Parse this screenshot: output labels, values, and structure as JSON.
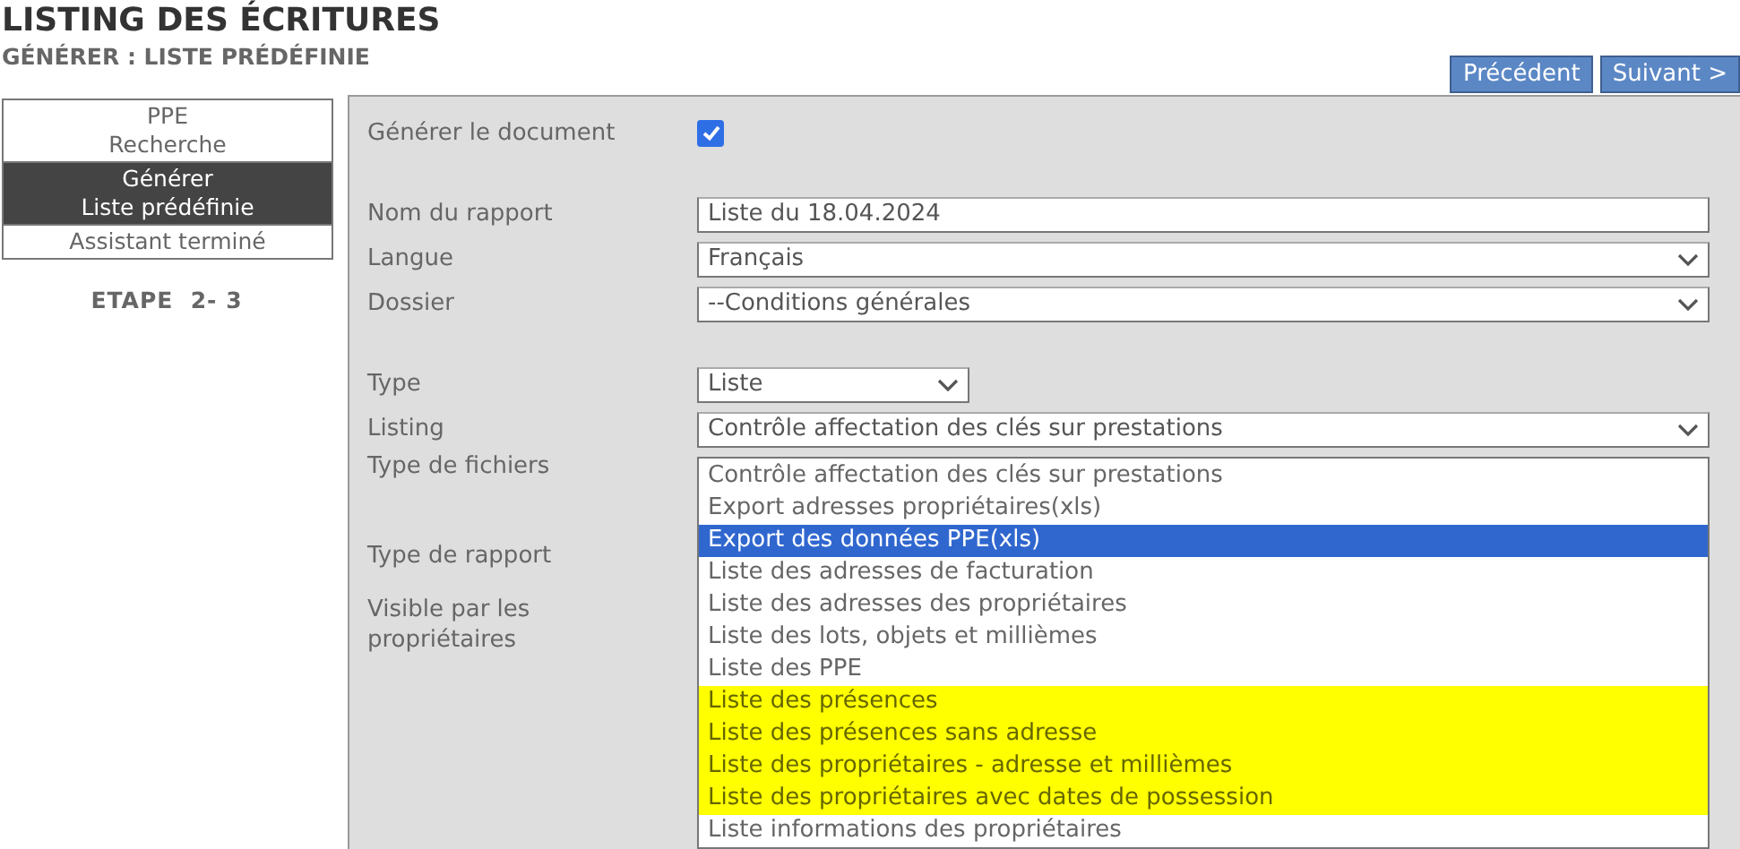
{
  "header": {
    "title": "LISTING DES ÉCRITURES",
    "subtitle": "GÉNÉRER : LISTE PRÉDÉFINIE"
  },
  "nav_buttons": [
    "Précédent",
    "Suivant >"
  ],
  "steps": [
    {
      "lines": [
        "PPE",
        "Recherche"
      ],
      "selected": false
    },
    {
      "lines": [
        "Générer",
        "Liste prédéfinie"
      ],
      "selected": true
    },
    {
      "lines": [
        "Assistant terminé"
      ],
      "selected": false
    }
  ],
  "step_counter": "ETAPE  2- 3",
  "form": [
    {
      "kind": "checkbox",
      "label": "Générer le document",
      "checked": true
    },
    {
      "kind": "gap"
    },
    {
      "kind": "text",
      "label": "Nom du rapport",
      "value": "Liste du 18.04.2024"
    },
    {
      "kind": "select",
      "label": "Langue",
      "value": "Français"
    },
    {
      "kind": "select",
      "label": "Dossier",
      "value": "--Conditions générales"
    },
    {
      "kind": "gap"
    },
    {
      "kind": "short-select",
      "label": "Type",
      "value": "Liste"
    },
    {
      "kind": "select",
      "label": "Listing",
      "value": "Contrôle affectation des clés sur prestations"
    },
    {
      "kind": "label",
      "label": "Type de fichiers"
    },
    {
      "kind": "gap"
    },
    {
      "kind": "label",
      "label": "Type de rapport"
    },
    {
      "kind": "label",
      "label": "Visible par les propriétaires"
    }
  ],
  "dropdown_options": [
    {
      "label": "Contrôle affectation des clés sur prestations",
      "selected": false,
      "marked": false
    },
    {
      "label": "Export adresses propriétaires(xls)",
      "selected": false,
      "marked": false
    },
    {
      "label": "Export des données PPE(xls)",
      "selected": true,
      "marked": false
    },
    {
      "label": "Liste des adresses de facturation",
      "selected": false,
      "marked": false
    },
    {
      "label": "Liste des adresses des propriétaires",
      "selected": false,
      "marked": false
    },
    {
      "label": "Liste des lots, objets et millièmes",
      "selected": false,
      "marked": false
    },
    {
      "label": "Liste des PPE",
      "selected": false,
      "marked": false
    },
    {
      "label": "Liste des présences",
      "selected": false,
      "marked": true
    },
    {
      "label": "Liste des présences sans adresse",
      "selected": false,
      "marked": true
    },
    {
      "label": "Liste des propriétaires - adresse et millièmes",
      "selected": false,
      "marked": true
    },
    {
      "label": "Liste des propriétaires avec dates de possession",
      "selected": false,
      "marked": true
    },
    {
      "label": "Liste informations des propriétaires",
      "selected": false,
      "marked": false
    }
  ]
}
